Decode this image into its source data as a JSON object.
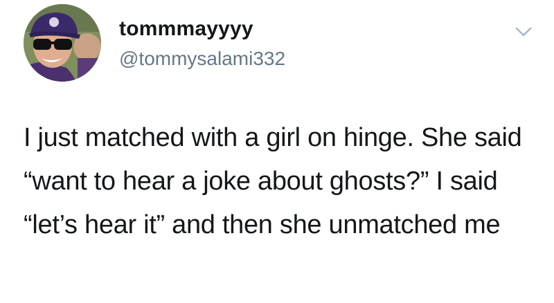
{
  "user": {
    "display_name": "tommmayyyy",
    "handle": "@tommysalami332",
    "avatar_icon": "profile-photo"
  },
  "tweet": {
    "text": "I just matched with a girl on hinge. She said “want to hear a joke about ghosts?” I said “let’s hear it” and then she unmatched me"
  },
  "menu": {
    "icon": "chevron-down-icon"
  },
  "colors": {
    "text": "#14171a",
    "secondary": "#657786",
    "chevron": "#aab8c2"
  }
}
